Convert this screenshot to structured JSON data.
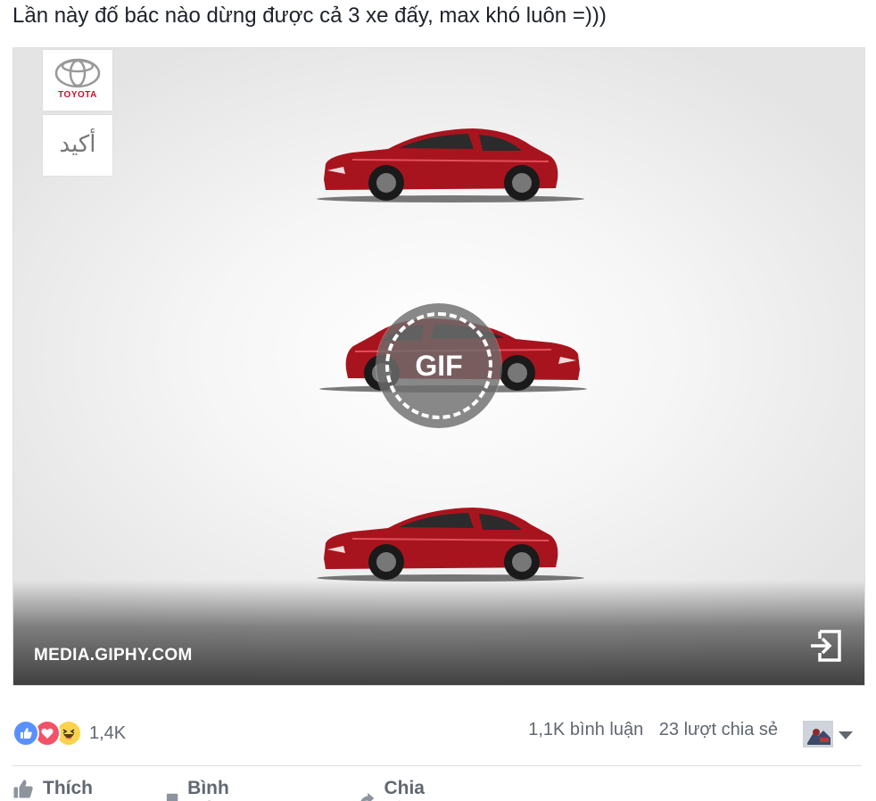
{
  "post": {
    "text": "Lần này đố bác nào dừng được cả 3 xe đấy, max khó luôn =)))"
  },
  "media": {
    "badge_label": "GIF",
    "source": "MEDIA.GIPHY.COM",
    "brand": "TOYOTA",
    "brand_arabic": "أكيد",
    "open_icon": "open-external-icon"
  },
  "reactions": {
    "types": [
      "like",
      "love",
      "haha"
    ],
    "count": "1,4K"
  },
  "stats": {
    "comments": "1,1K bình luận",
    "shares": "23 lượt chia sẻ"
  },
  "actions": {
    "like": "Thích",
    "comment": "Bình luận",
    "share": "Chia sẻ"
  },
  "colors": {
    "car_red": "#a8141e",
    "like_blue": "#5890ff",
    "love_red": "#f25268",
    "haha_yellow": "#fcd34d"
  }
}
